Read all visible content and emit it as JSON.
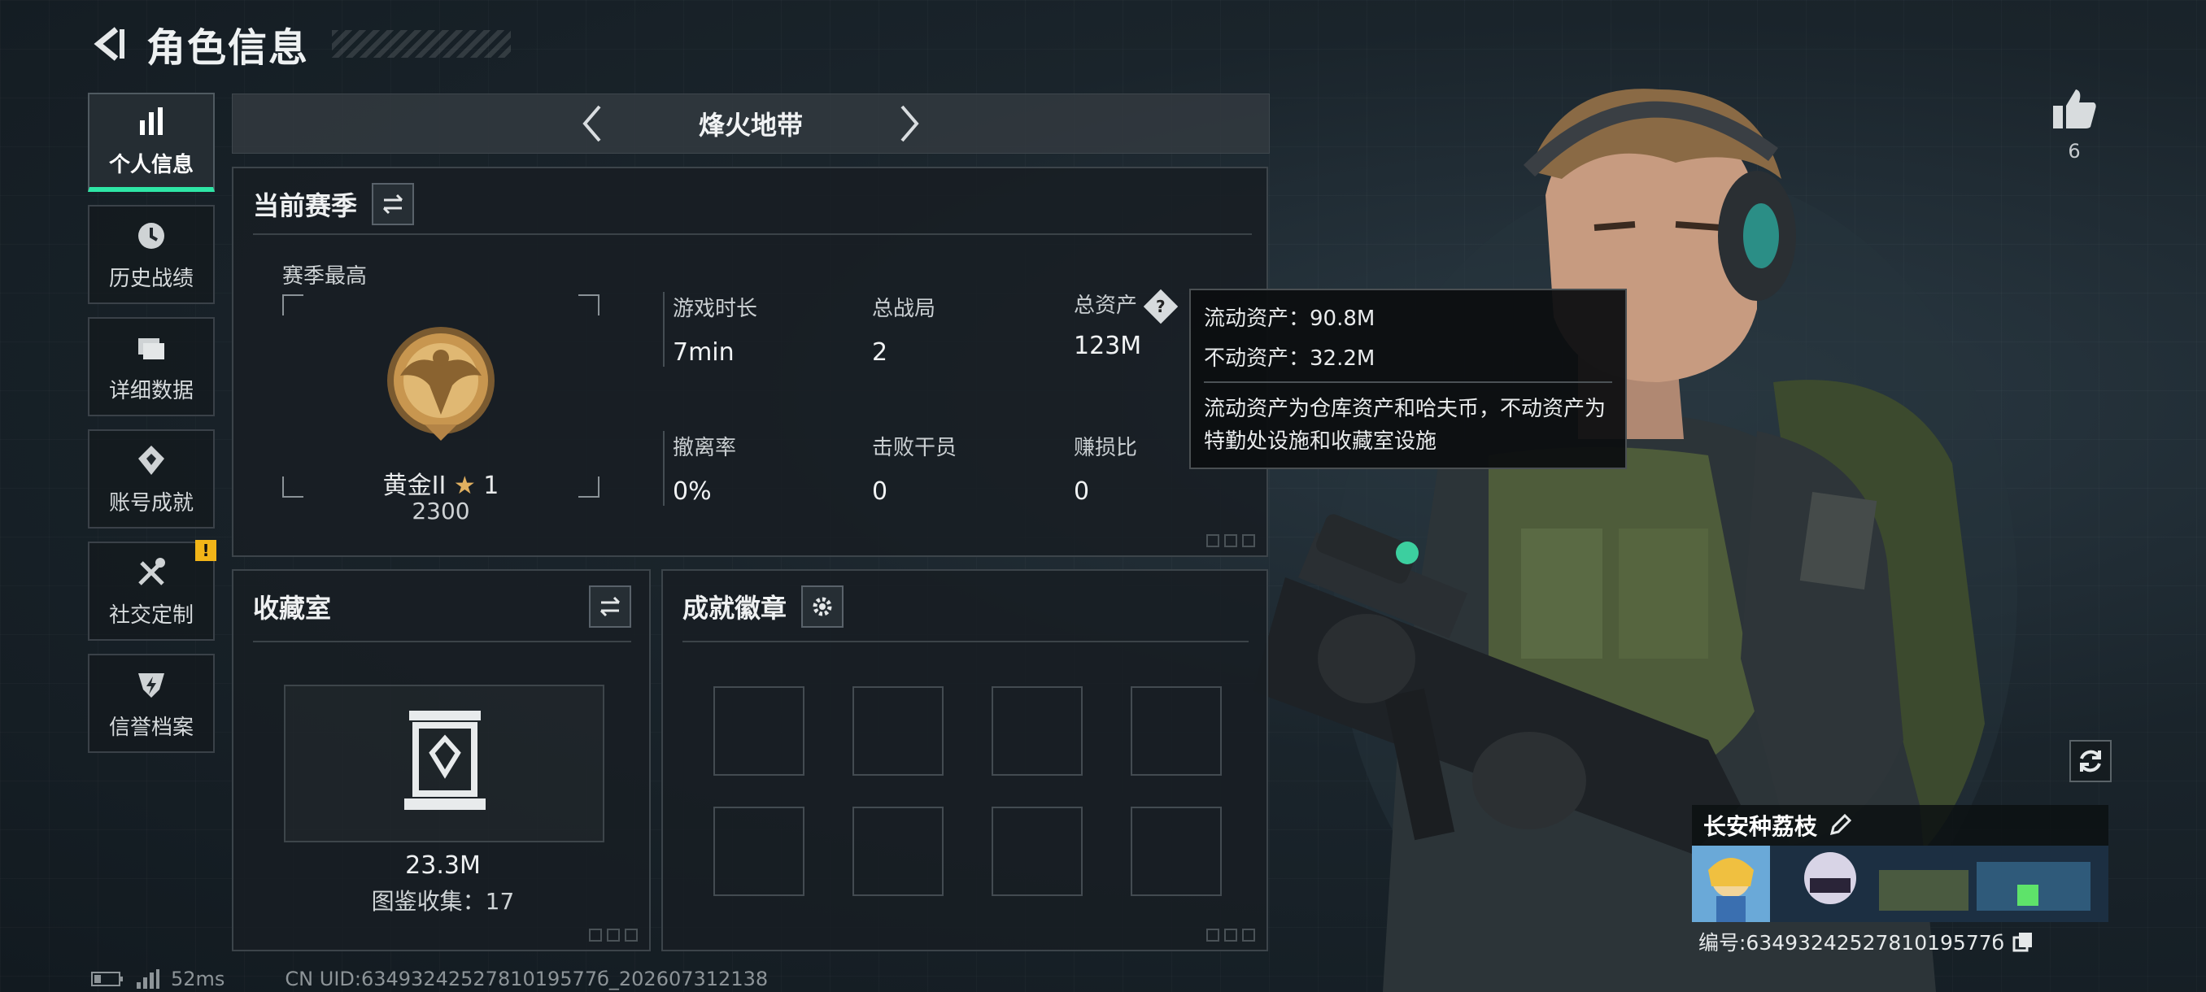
{
  "header": {
    "title": "角色信息"
  },
  "nav": {
    "items": [
      {
        "label": "个人信息",
        "icon": "bar-chart-icon",
        "active": true
      },
      {
        "label": "历史战绩",
        "icon": "clock-icon"
      },
      {
        "label": "详细数据",
        "icon": "folder-icon"
      },
      {
        "label": "账号成就",
        "icon": "badge-icon"
      },
      {
        "label": "社交定制",
        "icon": "tools-icon",
        "badge": "!"
      },
      {
        "label": "信誉档案",
        "icon": "shield-icon"
      }
    ]
  },
  "mode": {
    "current": "烽火地带"
  },
  "season": {
    "title": "当前赛季",
    "best_label": "赛季最高",
    "rank_name": "黄金II",
    "rank_stars": "1",
    "rank_score": "2300",
    "stats": [
      {
        "label": "游戏时长",
        "value": "7min"
      },
      {
        "label": "总战局",
        "value": "2"
      },
      {
        "label": "总资产",
        "value": "123M"
      },
      {
        "label": "撤离率",
        "value": "0%"
      },
      {
        "label": "击败干员",
        "value": "0"
      },
      {
        "label": "赚损比",
        "value": "0"
      }
    ]
  },
  "tooltip": {
    "liquid": "流动资产：90.8M",
    "fixed": "不动资产：32.2M",
    "desc": "流动资产为仓库资产和哈夫币，不动资产为特勤处设施和收藏室设施"
  },
  "collection": {
    "title": "收藏室",
    "value": "23.3M",
    "count": "图鉴收集：17"
  },
  "achievements": {
    "title": "成就徽章"
  },
  "likes": {
    "count": "6"
  },
  "player": {
    "name": "长安种荔枝",
    "id": "编号:6349324252781019577б"
  },
  "footer": {
    "ping": "52ms",
    "uid": "CN UID:6349324252781019577б_202607312138"
  },
  "colors": {
    "accent": "#2ee6a6",
    "warning": "#f2b518"
  }
}
